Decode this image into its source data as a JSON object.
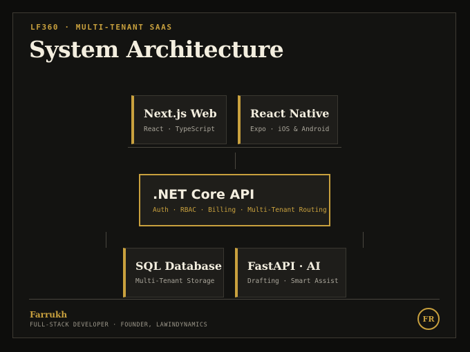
{
  "header": {
    "eyebrow": "LF360 · MULTI-TENANT SAAS",
    "title": "System Architecture"
  },
  "clients": [
    {
      "name": "Next.js Web",
      "tech": "React · TypeScript"
    },
    {
      "name": "React Native",
      "tech": "Expo · iOS & Android"
    }
  ],
  "api": {
    "name": ".NET Core API",
    "features": "Auth · RBAC · Billing · Multi-Tenant Routing"
  },
  "services": [
    {
      "name": "SQL Database",
      "tech": "Multi-Tenant Storage"
    },
    {
      "name": "FastAPI · AI",
      "tech": "Drafting · Smart Assist"
    }
  ],
  "footer": {
    "author": "Farrukh",
    "role": "FULL-STACK DEVELOPER · FOUNDER, LAWINDYNAMICS",
    "initials": "FR"
  },
  "colors": {
    "accent": "#c9a13e",
    "background": "#131311",
    "card": "#1e1d1a",
    "text": "#f3eedf"
  }
}
